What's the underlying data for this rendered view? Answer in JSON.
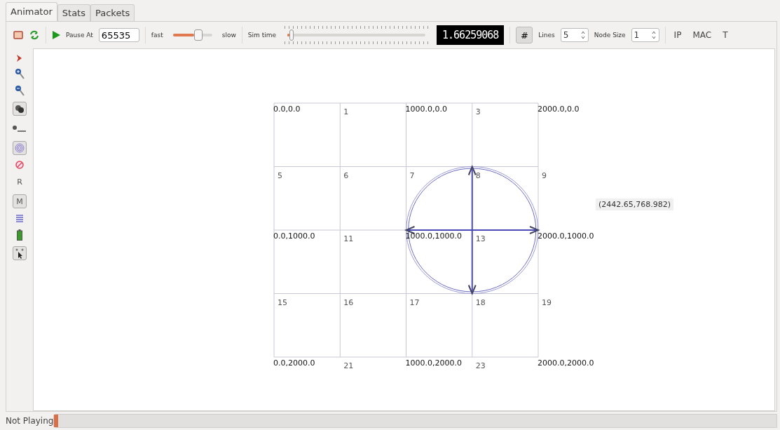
{
  "tabs": [
    {
      "label": "Animator",
      "selected": true
    },
    {
      "label": "Stats",
      "selected": false
    },
    {
      "label": "Packets",
      "selected": false
    }
  ],
  "toolbar": {
    "pause_label": "Pause At",
    "pause_value": "65535",
    "speed": {
      "fast": "fast",
      "slow": "slow",
      "level": 0.65
    },
    "sim_time": {
      "label": "Sim time",
      "level": 0.03,
      "display": "1.66259068"
    },
    "grid_button": {
      "symbol": "#",
      "pressed": true
    },
    "lines": {
      "label": "Lines",
      "value": "5"
    },
    "node_size": {
      "label": "Node Size",
      "value": "1"
    },
    "buttons": [
      "IP",
      "MAC",
      "T"
    ]
  },
  "side_tools": [
    {
      "kind": "chevron"
    },
    {
      "kind": "zoom-in"
    },
    {
      "kind": "zoom-out"
    },
    {
      "kind": "nodes",
      "pressed": true
    },
    {
      "kind": "nsid",
      "pressed": false
    },
    {
      "kind": "spiral",
      "pressed": true
    },
    {
      "kind": "no-sign"
    },
    {
      "kind": "text",
      "label": "R",
      "pressed": false
    },
    {
      "kind": "text",
      "label": "M",
      "pressed": true
    },
    {
      "kind": "lines"
    },
    {
      "kind": "battery"
    },
    {
      "kind": "cursor",
      "pressed": true
    }
  ],
  "canvas": {
    "nodes": [
      {
        "coordinate": "0.0,0.0"
      },
      {
        "label": "1"
      },
      {
        "coordinate": "1000.0,0.0"
      },
      {
        "label": "3"
      },
      {
        "coordinate": "2000.0,0.0"
      },
      {
        "label": "5"
      },
      {
        "label": "6"
      },
      {
        "label": "7"
      },
      {
        "label": "8"
      },
      {
        "label": "9"
      },
      {
        "coordinate": "0.0,1000.0"
      },
      {
        "label": "11"
      },
      {
        "coordinate": "1000.0,1000.0"
      },
      {
        "label": "13"
      },
      {
        "coordinate": "2000.0,1000.0"
      },
      {
        "label": "15"
      },
      {
        "label": "16"
      },
      {
        "label": "17"
      },
      {
        "label": "18"
      },
      {
        "label": "19"
      },
      {
        "coordinate": "0.0,2000.0"
      },
      {
        "label": "21"
      },
      {
        "coordinate": "1000.0,2000.0"
      },
      {
        "label": "23"
      },
      {
        "coordinate": "2000.0,2000.0"
      }
    ],
    "range_circle": true,
    "transmissions": [
      {
        "kind": "up"
      },
      {
        "kind": "left"
      },
      {
        "kind": "right"
      },
      {
        "kind": "down"
      }
    ],
    "mouse_position": "(2442.65,768.982)"
  },
  "status_bar": {
    "text": "Not Playing",
    "level": 0.005
  }
}
